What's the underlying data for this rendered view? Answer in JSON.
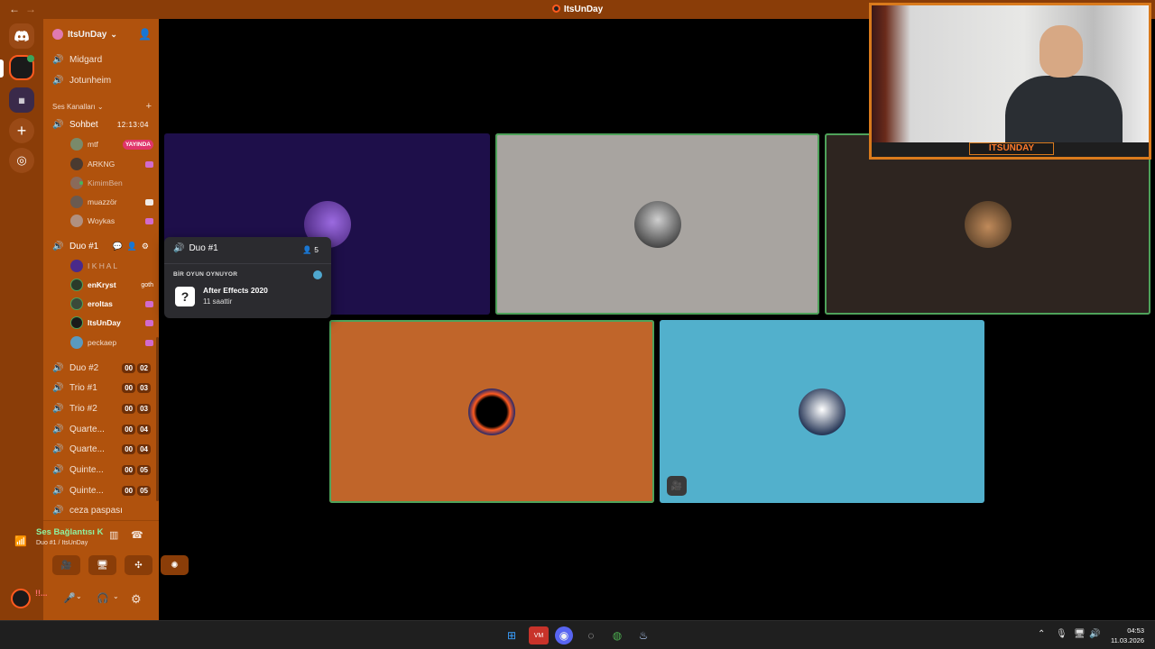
{
  "window": {
    "title": "ItsUnDay",
    "back": "←",
    "forward": "→"
  },
  "guildbar": {
    "items": [
      "discord-home",
      "itsunday-server",
      "server-folder",
      "add-server",
      "explore"
    ]
  },
  "server": {
    "name": "ItsUnDay",
    "chevron": "⌄"
  },
  "sidebar": {
    "channels_top": [
      {
        "name": "Midgard"
      },
      {
        "name": "Jotunheim"
      }
    ],
    "category": "Ses Kanalları",
    "sohbet": {
      "name": "Sohbet",
      "time": "12:13:04"
    },
    "sohbet_users": [
      {
        "name": "mtf",
        "badge": "YAYINDA"
      },
      {
        "name": "ARKNG"
      },
      {
        "name": "KimimBen"
      },
      {
        "name": "muazzör"
      },
      {
        "name": "Woykas"
      }
    ],
    "duo1": {
      "name": "Duo #1"
    },
    "duo1_users": [
      {
        "name": "I K H A L"
      },
      {
        "name": "enKryst",
        "status": "goth"
      },
      {
        "name": "eroltas"
      },
      {
        "name": "ItsUnDay"
      },
      {
        "name": "peckaep"
      }
    ],
    "channels_bottom": [
      {
        "name": "Duo #2",
        "a": "00",
        "b": "02"
      },
      {
        "name": "Trio #1",
        "a": "00",
        "b": "03"
      },
      {
        "name": "Trio #2",
        "a": "00",
        "b": "03"
      },
      {
        "name": "Quarte...",
        "a": "00",
        "b": "04"
      },
      {
        "name": "Quarte...",
        "a": "00",
        "b": "04"
      },
      {
        "name": "Quinte...",
        "a": "00",
        "b": "05"
      },
      {
        "name": "Quinte...",
        "a": "00",
        "b": "05"
      },
      {
        "name": "ceza paspası"
      }
    ]
  },
  "voice": {
    "status": "Ses Bağlantısı K",
    "channel": "Duo #1 / ItsUnDay"
  },
  "userbar": {
    "name": "!!..."
  },
  "popup": {
    "channel": "Duo #1",
    "count": "5",
    "label": "BİR OYUN OYNUYOR",
    "game": "After Effects 2020",
    "duration": "11 saattir"
  },
  "stage": {
    "tiles": [
      {
        "color": "#1e0f4a",
        "speaking": false
      },
      {
        "color": "#a8a4a0",
        "speaking": true
      },
      {
        "color": "#2e2520",
        "speaking": true
      },
      {
        "color": "#c0652a",
        "speaking": true
      },
      {
        "color": "#52b0cc",
        "speaking": false,
        "muted": true
      }
    ]
  },
  "webcam": {
    "label": "ITSUNDAY"
  },
  "taskbar": {
    "time": "04:53",
    "date": "11.03.2026"
  }
}
